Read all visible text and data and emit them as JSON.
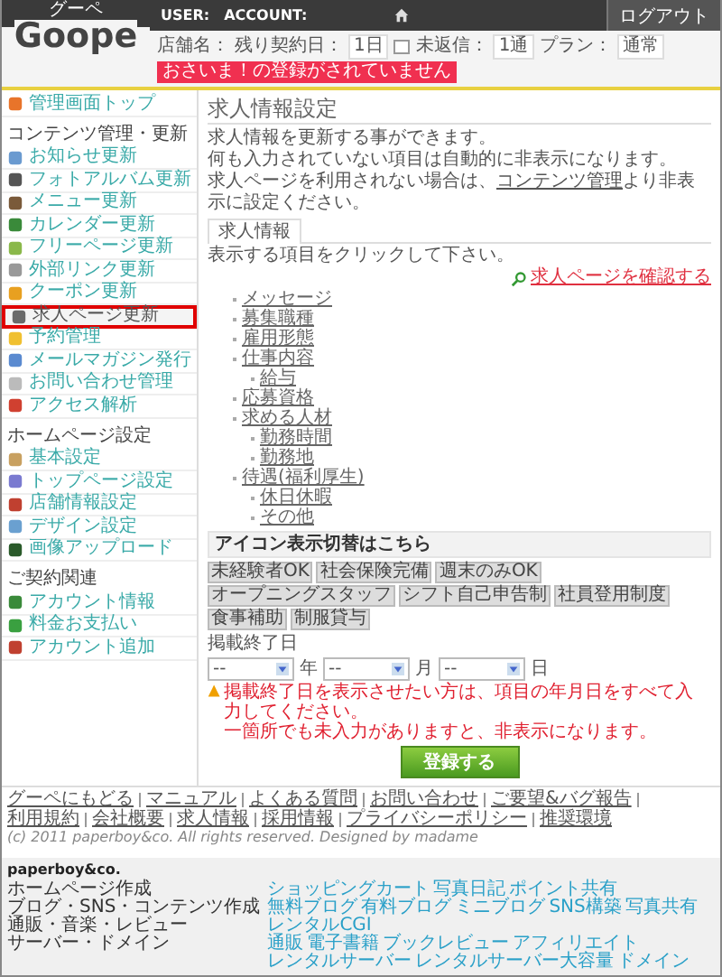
{
  "header": {
    "user_label": "USER:",
    "account_label": "ACCOUNT:",
    "logout": "ログアウト",
    "logo_small": "グーペ",
    "logo": "Goope"
  },
  "status": {
    "shop_label": "店舗名：",
    "days_label": "残り契約日：",
    "days": "1日",
    "unread_label": "未返信：",
    "unread": "1通",
    "plan_label": "プラン：",
    "plan": "通常",
    "alert": "おさいま！の登録がされていません"
  },
  "sidebar": [
    {
      "items": [
        {
          "label": "管理画面トップ",
          "selected": false
        }
      ]
    },
    {
      "title": "コンテンツ管理・更新",
      "items": [
        {
          "label": "お知らせ更新",
          "selected": false
        },
        {
          "label": "フォトアルバム更新",
          "selected": false
        },
        {
          "label": "メニュー更新",
          "selected": false
        },
        {
          "label": "カレンダー更新",
          "selected": false
        },
        {
          "label": "フリーページ更新",
          "selected": false
        },
        {
          "label": "外部リンク更新",
          "selected": false
        },
        {
          "label": "クーポン更新",
          "selected": false
        },
        {
          "label": "求人ページ更新",
          "selected": true
        },
        {
          "label": "予約管理",
          "selected": false
        },
        {
          "label": "メールマガジン発行",
          "selected": false
        },
        {
          "label": "お問い合わせ管理",
          "selected": false
        },
        {
          "label": "アクセス解析",
          "selected": false
        }
      ]
    },
    {
      "title": "ホームページ設定",
      "items": [
        {
          "label": "基本設定",
          "selected": false
        },
        {
          "label": "トップページ設定",
          "selected": false
        },
        {
          "label": "店舗情報設定",
          "selected": false
        },
        {
          "label": "デザイン設定",
          "selected": false
        },
        {
          "label": "画像アップロード",
          "selected": false
        }
      ]
    },
    {
      "title": "ご契約関連",
      "items": [
        {
          "label": "アカウント情報",
          "selected": false
        },
        {
          "label": "料金お支払い",
          "selected": false
        },
        {
          "label": "アカウント追加",
          "selected": false
        }
      ]
    }
  ],
  "main": {
    "title": "求人情報設定",
    "description": [
      "求人情報を更新する事ができます。",
      "何も入力されていない項目は自動的に非表示になります。",
      {
        "before": "求人ページを利用されない場合は、",
        "link": "コンテンツ管理",
        "after": "より非表示に設定ください。"
      }
    ],
    "tabs": [
      {
        "label": "求人情報",
        "selected": true
      }
    ],
    "instruction": "表示する項目をクリックして下さい。",
    "preview_link": "求人ページを確認する",
    "items": [
      {
        "label": "メッセージ"
      },
      {
        "label": "募集職種"
      },
      {
        "label": "雇用形態"
      },
      {
        "label": "仕事内容",
        "children": [
          {
            "label": "給与"
          }
        ]
      },
      {
        "label": "応募資格"
      },
      {
        "label": "求める人材",
        "children": [
          {
            "label": "勤務時間"
          },
          {
            "label": "勤務地"
          }
        ]
      },
      {
        "label": "待遇(福利厚生)",
        "children": [
          {
            "label": "休日休暇"
          },
          {
            "label": "その他"
          }
        ]
      }
    ],
    "icon_heading": "アイコン表示切替はこちら",
    "badges": [
      "未経験者OK",
      "社会保険完備",
      "週末のみOK",
      "オープニングスタッフ",
      "シフト自己申告制",
      "社員登用制度",
      "食事補助",
      "制服貸与"
    ],
    "date_label": "掲載終了日",
    "date_fields": [
      {
        "value": "--",
        "unit": "年"
      },
      {
        "value": "--",
        "unit": "月"
      },
      {
        "value": "--",
        "unit": "日"
      }
    ],
    "warning": [
      "掲載終了日を表示させたい方は、項目の年月日をすべて入力してください。",
      "一箇所でも未入力がありますと、非表示になります。"
    ],
    "submit": "登録する"
  },
  "footer_links": [
    "グーペにもどる",
    "マニュアル",
    "よくある質問",
    "お問い合わせ",
    "ご要望&バグ報告",
    "利用規約",
    "会社概要",
    "求人情報",
    "採用情報",
    "プライバシーポリシー",
    "推奨環境"
  ],
  "copyright": "(c) 2011 paperboy&co. All rights reserved. Designed by madame",
  "company": {
    "logo": "paperboy&co.",
    "categories": [
      "ホームページ作成",
      "ブログ・SNS・コンテンツ作成",
      "通販・音楽・レビュー",
      "サーバー・ドメイン"
    ],
    "services": [
      [
        "ショッピングカート",
        "写真日記",
        "ポイント共有"
      ],
      [
        "無料ブログ",
        "有料ブログ",
        "ミニブログ",
        "SNS構築",
        "写真共有",
        "レンタルCGI"
      ],
      [
        "通販",
        "電子書籍",
        "ブックレビュー",
        "アフィリエイト"
      ],
      [
        "レンタルサーバー",
        "レンタルサーバー大容量",
        "ドメイン"
      ]
    ]
  }
}
